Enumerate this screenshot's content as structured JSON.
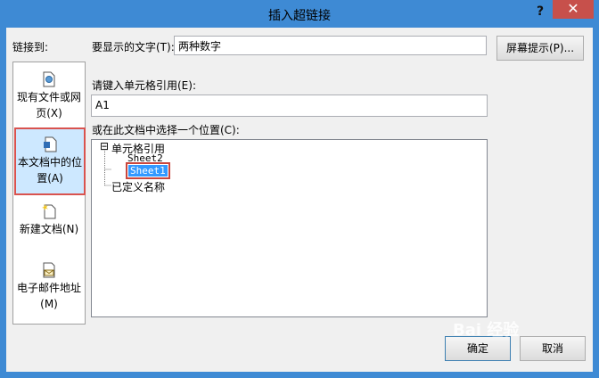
{
  "dialog": {
    "title": "插入超链接",
    "help_label": "?",
    "close_label": "✕"
  },
  "link_to": {
    "label": "链接到:",
    "items": [
      {
        "label_line1": "现有文件或网",
        "label_line2": "页(X)",
        "icon": "globe-page-icon",
        "selected": false
      },
      {
        "label_line1": "本文档中的位",
        "label_line2": "置(A)",
        "icon": "document-location-icon",
        "selected": true
      },
      {
        "label_line1": "新建文档(N)",
        "label_line2": "",
        "icon": "new-document-icon",
        "selected": false
      },
      {
        "label_line1": "电子邮件地址",
        "label_line2": "(M)",
        "icon": "email-icon",
        "selected": false
      }
    ]
  },
  "display_text": {
    "label": "要显示的文字(T):",
    "value": "两种数字"
  },
  "screen_tip_button": "屏幕提示(P)...",
  "cell_ref": {
    "label": "请键入单元格引用(E):",
    "value": "A1"
  },
  "place": {
    "label": "或在此文档中选择一个位置(C):",
    "tree": {
      "root": "单元格引用",
      "expander": "⊟",
      "children": [
        "Sheet2",
        "Sheet1"
      ],
      "selected_child": "Sheet1",
      "defined_names": "已定义名称"
    }
  },
  "ok_button": "确定",
  "cancel_button": "取消",
  "watermark": "Bai 经验",
  "colors": {
    "titlebar": "#3e8ad4",
    "close_button": "#c7504b",
    "highlight_border": "#d9534f",
    "selection": "#3399ff"
  }
}
